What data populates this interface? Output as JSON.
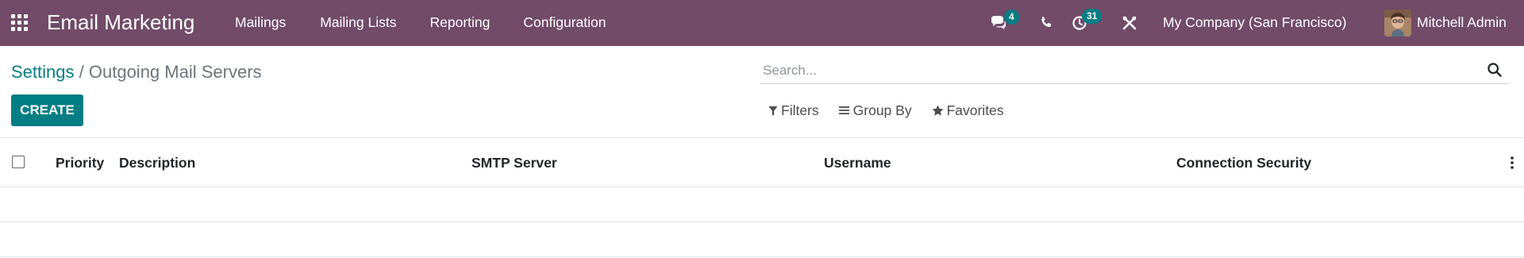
{
  "navbar": {
    "app_name": "Email Marketing",
    "menu": [
      "Mailings",
      "Mailing Lists",
      "Reporting",
      "Configuration"
    ],
    "messages_badge": "4",
    "activities_badge": "31",
    "company": "My Company (San Francisco)",
    "user_name": "Mitchell Admin"
  },
  "breadcrumb": {
    "parent": "Settings",
    "separator": "/",
    "current": "Outgoing Mail Servers"
  },
  "actions": {
    "create_label": "CREATE"
  },
  "search": {
    "placeholder": "Search...",
    "filters_label": "Filters",
    "group_by_label": "Group By",
    "favorites_label": "Favorites"
  },
  "table": {
    "columns": [
      "Priority",
      "Description",
      "SMTP Server",
      "Username",
      "Connection Security"
    ]
  },
  "colors": {
    "navbar": "#714b67",
    "accent": "#017e84"
  }
}
